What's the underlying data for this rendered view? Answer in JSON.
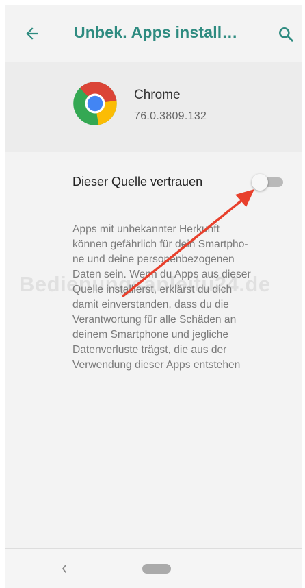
{
  "appbar": {
    "title": "Unbek. Apps install…",
    "back_icon": "arrow-back-icon",
    "search_icon": "search-icon",
    "accent_color": "#2e8b80"
  },
  "app": {
    "name": "Chrome",
    "version": "76.0.3809.132",
    "icon": "chrome-logo-icon"
  },
  "setting": {
    "label": "Dieser Quelle vertrauen",
    "enabled": false
  },
  "description": {
    "lines": [
      "Apps mit unbekannter Herkunft",
      "können gefährlich für dein Smartpho-",
      "ne und deine personenbezogenen",
      "Daten sein. Wenn du Apps aus dieser",
      "Quelle installierst, erklärst du dich",
      "damit einverstanden, dass du die",
      "Verantwortung für alle Schäden an",
      "deinem Smartphone und jegliche",
      "Datenverluste trägst, die aus der",
      "Verwendung dieser Apps entstehen"
    ]
  },
  "watermark": "Bedienungsanleitu24.de",
  "annotation": {
    "arrow_color": "#e8402c"
  },
  "navbar": {
    "back_icon": "nav-back-icon",
    "home_icon": "home-pill-icon"
  }
}
